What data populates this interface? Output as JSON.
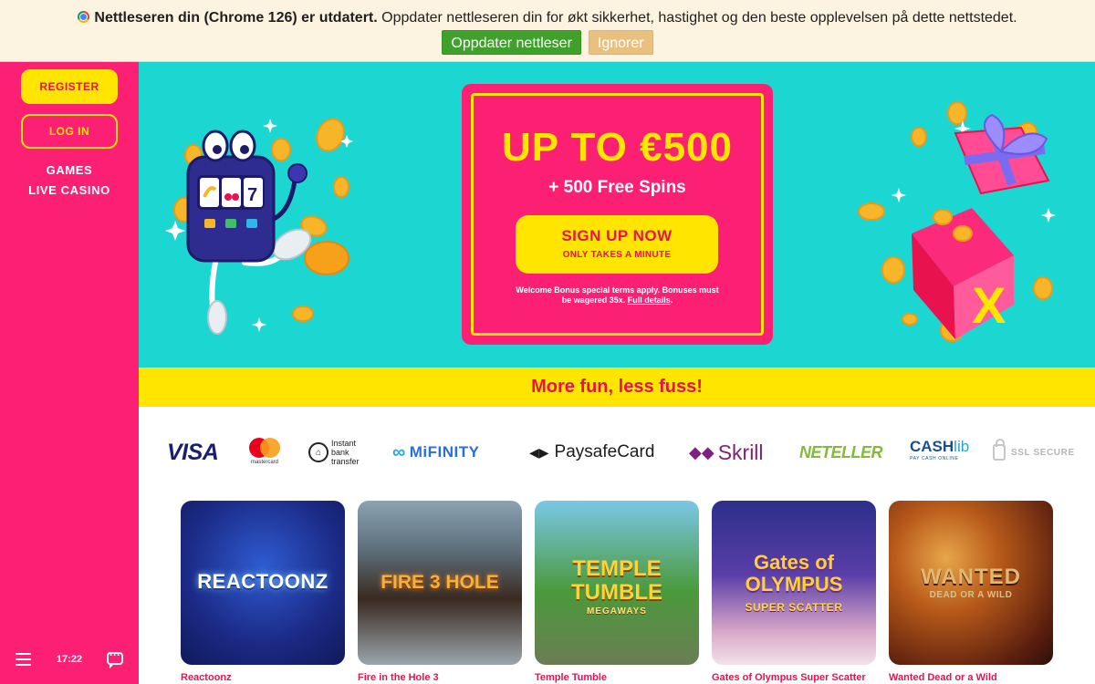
{
  "browser_banner": {
    "bold_text": "Nettleseren din (Chrome 126) er utdatert.",
    "text": " Oppdater nettleseren din for økt sikkerhet, hastighet og den beste opplevelsen på dette nettstedet.",
    "update_label": "Oppdater nettleser",
    "ignore_label": "Ignorer",
    "icon": "chrome-icon"
  },
  "sidebar": {
    "register_label": "REGISTER",
    "login_label": "LOG IN",
    "nav": [
      {
        "label": "GAMES"
      },
      {
        "label": "LIVE CASINO"
      }
    ],
    "clock": "17:22",
    "icons": [
      "menu-icon",
      "chat-icon"
    ]
  },
  "hero": {
    "title": "UP TO €500",
    "subtitle": "+ 500 Free Spins",
    "signup_label": "SIGN UP NOW",
    "signup_sub": "ONLY TAKES A MINUTE",
    "terms_text": "Welcome Bonus special terms apply. Bonuses must be wagered 35x. ",
    "terms_link": "Full details",
    "terms_end": "."
  },
  "tagline": "More fun, less fuss!",
  "payments": {
    "visa": "VISA",
    "mastercard": "mastercard",
    "bank_text": [
      "Instant",
      "bank",
      "transfer"
    ],
    "mifinity": "MiFINITY",
    "paysafecard": "PaysafeCard",
    "skrill": "Skrill",
    "neteller": "NETELLER",
    "cashlib_a": "CASH",
    "cashlib_b": "lib",
    "cashlib_sub": "PAY CASH ONLINE",
    "ssl": "SSL SECURE"
  },
  "games": [
    {
      "title": "Reactoonz",
      "logo": "REACTOONZ"
    },
    {
      "title": "Fire in the Hole 3",
      "logo": "FIRE 3 HOLE"
    },
    {
      "title": "Temple Tumble",
      "logo": "TEMPLE TUMBLE",
      "logo_sub": "MEGAWAYS"
    },
    {
      "title": "Gates of Olympus Super Scatter",
      "logo": "Gates of OLYMPUS",
      "logo_sub": "SUPER SCATTER"
    },
    {
      "title": "Wanted Dead or a Wild",
      "logo": "WANTED",
      "logo_sub": "DEAD OR A WILD"
    }
  ],
  "colors": {
    "sidebar_pink": "#fb2073",
    "hero_teal": "#1cd7d1",
    "yellow": "#ffe500",
    "brand_red": "#e8124f",
    "update_green": "#3fa02c",
    "ignore_tan": "#e9c07e"
  }
}
